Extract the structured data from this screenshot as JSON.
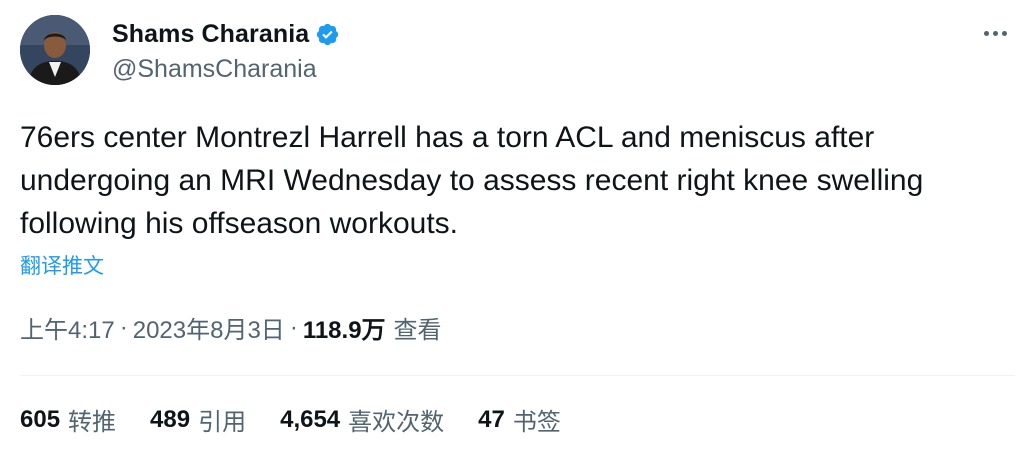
{
  "author": {
    "display_name": "Shams Charania",
    "handle": "@ShamsCharania",
    "verified": true,
    "verified_color": "#1d9bf0"
  },
  "more_icon": "more-horizontal-icon",
  "tweet": {
    "text": "76ers center Montrezl Harrell has a torn ACL and meniscus after\nundergoing an MRI Wednesday to assess recent right knee swelling\nfollowing his offseason workouts.",
    "translate_label": "翻译推文"
  },
  "meta": {
    "time": "上午4:17",
    "separator": "·",
    "date": "2023年8月3日",
    "views_count": "118.9万",
    "views_label": "查看"
  },
  "stats": [
    {
      "count": "605",
      "label": "转推"
    },
    {
      "count": "489",
      "label": "引用"
    },
    {
      "count": "4,654",
      "label": "喜欢次数"
    },
    {
      "count": "47",
      "label": "书签"
    }
  ],
  "colors": {
    "text_primary": "#0f1419",
    "text_secondary": "#536471",
    "link": "#1d9bf0",
    "divider": "#eff3f4"
  }
}
